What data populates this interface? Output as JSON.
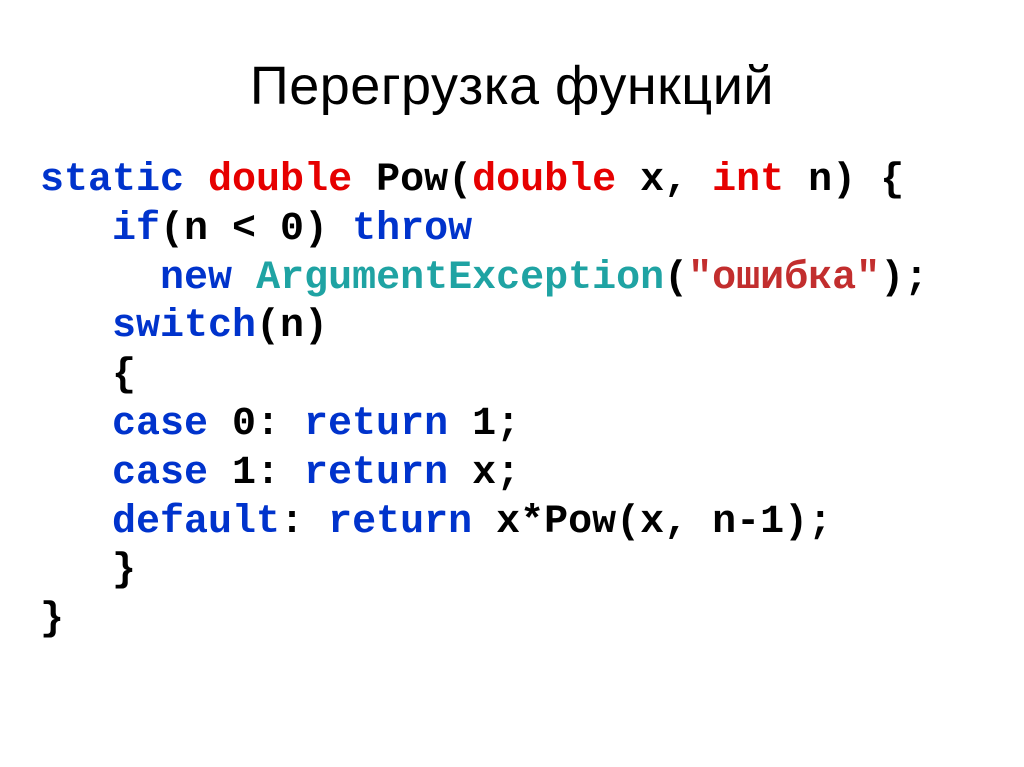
{
  "title": "Перегрузка функций",
  "code": {
    "l1": {
      "kw1": "static",
      "sp1": " ",
      "type1": "double",
      "sp2": " ",
      "fn": "Pow(",
      "type2": "double",
      "arg1": " x, ",
      "type3": "int",
      "arg2": " n) {"
    },
    "l2": {
      "indent": "   ",
      "kw1": "if",
      "mid": "(n < 0)",
      "sp": " ",
      "kw2": "throw"
    },
    "l3": {
      "indent": "     ",
      "kw1": "new",
      "sp": " ",
      "cls": "ArgumentException",
      "p1": "(",
      "str": "\"ошибка\"",
      "p2": ");"
    },
    "l4": {
      "indent": "   ",
      "kw1": "switch",
      "rest": "(n)"
    },
    "l5": {
      "indent": "   ",
      "brace": "{"
    },
    "l6": {
      "indent": "   ",
      "kw1": "case",
      "mid": " 0: ",
      "kw2": "return",
      "rest": " 1;"
    },
    "l7": {
      "indent": "   ",
      "kw1": "case",
      "mid": " 1: ",
      "kw2": "return",
      "rest": " x;"
    },
    "l8": {
      "indent": "   ",
      "kw1": "default",
      "mid": ": ",
      "kw2": "return",
      "rest": " x*Pow(x, n-1);"
    },
    "l9": {
      "indent": "   ",
      "brace": "}"
    },
    "l10": {
      "brace": "}"
    }
  }
}
